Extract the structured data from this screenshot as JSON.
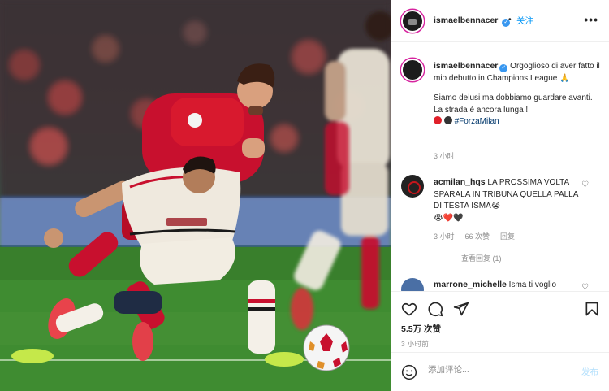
{
  "post": {
    "username": "ismaelbennacer",
    "follow_label": "关注",
    "more_label": "•••",
    "verified_mark": "✓"
  },
  "caption": {
    "username": "ismaelbennacer",
    "line1": "Orgoglioso di aver fatto il mio debutto in Champions League 🙏",
    "line2": "Siamo delusi ma dobbiamo guardare avanti. La strada è ancora lunga !",
    "hashtag": "#ForzaMilan",
    "emoji_colors": [
      "#e0202a",
      "#333333"
    ],
    "time": "3 小时"
  },
  "comments": [
    {
      "username": "acmilan_hqs",
      "text": "LA PROSSIMA VOLTA SPARALA IN TRIBUNA QUELLA PALLA DI TESTA ISMA😭",
      "emojis": "😭❤️🖤",
      "time": "3 小时",
      "likes": "66 次赞",
      "reply": "回复",
      "view_replies": "查看回复 (1)"
    },
    {
      "username": "marrone_michelle",
      "text": "Isma ti voglio"
    }
  ],
  "actions": {
    "likes": "5.5万 次赞",
    "time": "3 小时前"
  },
  "add_comment": {
    "placeholder": "添加评论...",
    "publish": "发布"
  },
  "colors": {
    "accent": "#0095f6",
    "verified": "#3897f0",
    "liverpool_red": "#c8102e",
    "milan_away": "#efe9de",
    "pitch_green": "#3d8a2f"
  }
}
